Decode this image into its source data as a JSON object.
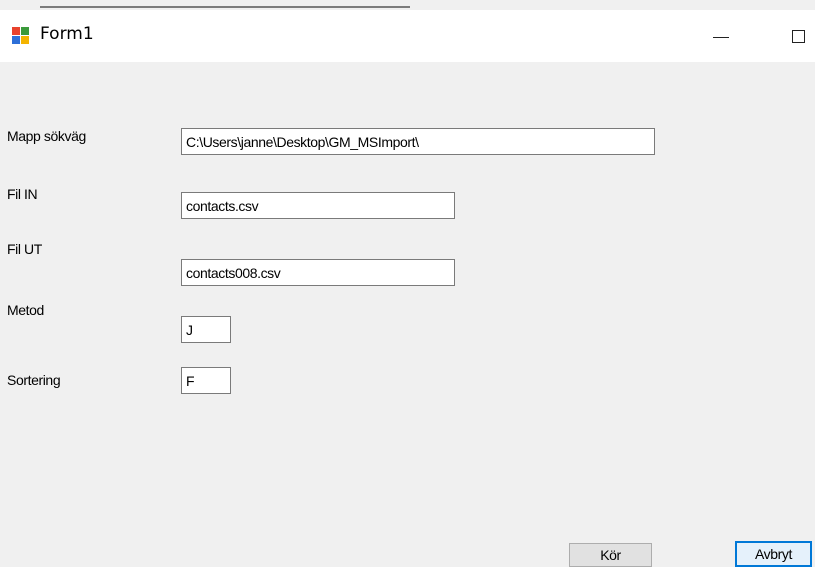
{
  "window": {
    "title": "Form1",
    "icon": "windows-form-icon",
    "controls": [
      "minimize-icon",
      "maximize-icon"
    ]
  },
  "form": {
    "folder_path": {
      "label": "Mapp sökväg",
      "value": "C:\\Users\\janne\\Desktop\\GM_MSImport\\"
    },
    "file_in": {
      "label": "Fil IN",
      "value": "contacts.csv"
    },
    "file_out": {
      "label": "Fil UT",
      "value": "contacts008.csv"
    },
    "method": {
      "label": "Metod",
      "value": "J"
    },
    "sorting": {
      "label": "Sortering",
      "value": "F"
    }
  },
  "buttons": {
    "run_label": "Kör",
    "cancel_label": "Avbryt"
  },
  "colors": {
    "form_background": "#f0f0f0",
    "title_bar": "#ffffff",
    "focus_border": "#0078d7"
  }
}
